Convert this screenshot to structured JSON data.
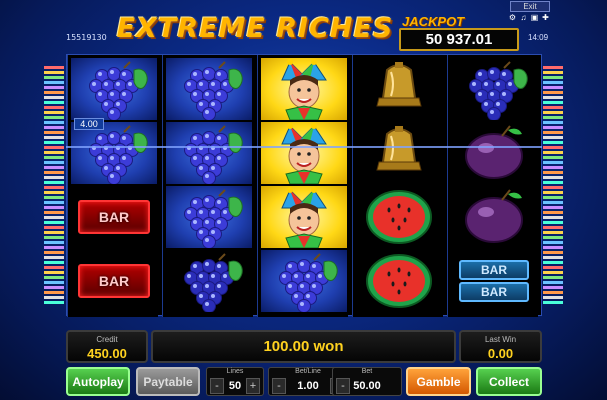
{
  "header": {
    "session_id": "15519130",
    "title": "EXTREME RICHES",
    "jackpot_label": "JACKPOT",
    "jackpot_value": "50 937.01",
    "clock": "14:09",
    "exit_label": "Exit"
  },
  "reels": {
    "line_value": "4.00",
    "columns": [
      [
        "grapes",
        "grapes",
        "bar",
        "bar"
      ],
      [
        "grapes",
        "grapes",
        "grapes",
        "grapes"
      ],
      [
        "joker",
        "joker",
        "joker",
        "grapes"
      ],
      [
        "bell",
        "bell",
        "watermelon",
        "watermelon"
      ],
      [
        "grapes",
        "plum",
        "plum",
        "double-bar"
      ]
    ],
    "bar_text": "BAR"
  },
  "status": {
    "credit_label": "Credit",
    "credit_value": "450.00",
    "won_text": "100.00 won",
    "last_win_label": "Last Win",
    "last_win_value": "0.00"
  },
  "controls": {
    "autoplay_label": "Autoplay",
    "paytable_label": "Paytable",
    "lines_label": "Lines",
    "lines_value": "50",
    "betline_label": "Bet/Line",
    "betline_value": "1.00",
    "bet_label": "Bet",
    "bet_value": "50.00",
    "gamble_label": "Gamble",
    "collect_label": "Collect",
    "minus": "-",
    "plus": "+"
  },
  "colors": {
    "accent_gold": "#ffb400",
    "win_text": "#ffd21f"
  }
}
